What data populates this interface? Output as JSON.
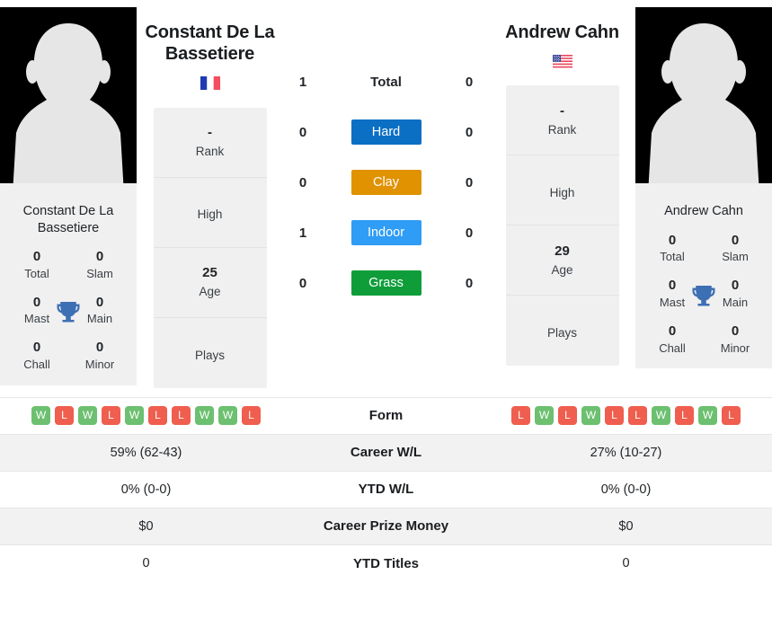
{
  "players": {
    "left": {
      "name": "Constant De La Bassetiere",
      "flag_country": "France",
      "flag_code": "FR",
      "photo_alt": "player-photo-placeholder",
      "titles_card_name": "Constant De La Bassetiere",
      "titles": [
        {
          "value": "0",
          "label": "Total"
        },
        {
          "value": "0",
          "label": "Slam"
        },
        {
          "value": "0",
          "label": "Mast"
        },
        {
          "value": "0",
          "label": "Main"
        },
        {
          "value": "0",
          "label": "Chall"
        },
        {
          "value": "0",
          "label": "Minor"
        }
      ],
      "info": [
        {
          "value": "-",
          "label": "Rank"
        },
        {
          "value": "",
          "label": "High"
        },
        {
          "value": "25",
          "label": "Age"
        },
        {
          "value": "",
          "label": "Plays"
        }
      ],
      "form": [
        "W",
        "L",
        "W",
        "L",
        "W",
        "L",
        "L",
        "W",
        "W",
        "L"
      ],
      "career_wl": "59% (62-43)",
      "ytd_wl": "0% (0-0)",
      "career_prize_money": "$0",
      "ytd_titles": "0"
    },
    "right": {
      "name": "Andrew Cahn",
      "flag_country": "United States",
      "flag_code": "US",
      "photo_alt": "player-photo-placeholder",
      "titles_card_name": "Andrew Cahn",
      "titles": [
        {
          "value": "0",
          "label": "Total"
        },
        {
          "value": "0",
          "label": "Slam"
        },
        {
          "value": "0",
          "label": "Mast"
        },
        {
          "value": "0",
          "label": "Main"
        },
        {
          "value": "0",
          "label": "Chall"
        },
        {
          "value": "0",
          "label": "Minor"
        }
      ],
      "info": [
        {
          "value": "-",
          "label": "Rank"
        },
        {
          "value": "",
          "label": "High"
        },
        {
          "value": "29",
          "label": "Age"
        },
        {
          "value": "",
          "label": "Plays"
        }
      ],
      "form": [
        "L",
        "W",
        "L",
        "W",
        "L",
        "L",
        "W",
        "L",
        "W",
        "L"
      ],
      "career_wl": "27% (10-27)",
      "ytd_wl": "0% (0-0)",
      "career_prize_money": "$0",
      "ytd_titles": "0"
    }
  },
  "head_to_head": {
    "rows": [
      {
        "label": "Total",
        "left": "1",
        "right": "0",
        "badge": false,
        "color": ""
      },
      {
        "label": "Hard",
        "left": "0",
        "right": "0",
        "badge": true,
        "color": "#0b6fc4"
      },
      {
        "label": "Clay",
        "left": "0",
        "right": "0",
        "badge": true,
        "color": "#e09200"
      },
      {
        "label": "Indoor",
        "left": "1",
        "right": "0",
        "badge": true,
        "color": "#2f9cf5"
      },
      {
        "label": "Grass",
        "left": "0",
        "right": "0",
        "badge": true,
        "color": "#0f9d3a"
      }
    ]
  },
  "stats_rows": [
    {
      "label": "Form",
      "kind": "form"
    },
    {
      "label": "Career W/L",
      "kind": "text",
      "key": "career_wl"
    },
    {
      "label": "YTD W/L",
      "kind": "text",
      "key": "ytd_wl"
    },
    {
      "label": "Career Prize Money",
      "kind": "text",
      "key": "career_prize_money"
    },
    {
      "label": "YTD Titles",
      "kind": "text",
      "key": "ytd_titles"
    }
  ],
  "colors": {
    "win": "#6cc070",
    "loss": "#ef5e4e",
    "hard": "#0b6fc4",
    "clay": "#e09200",
    "indoor": "#2f9cf5",
    "grass": "#0f9d3a",
    "trophy": "#3d6fb4",
    "card_bg": "#f0f0f0",
    "stripe_bg": "#f2f2f2"
  },
  "icons": {
    "trophy": "trophy-icon",
    "avatar": "avatar-placeholder-icon",
    "flag_fr": "flag-france-icon",
    "flag_us": "flag-united-states-icon"
  }
}
